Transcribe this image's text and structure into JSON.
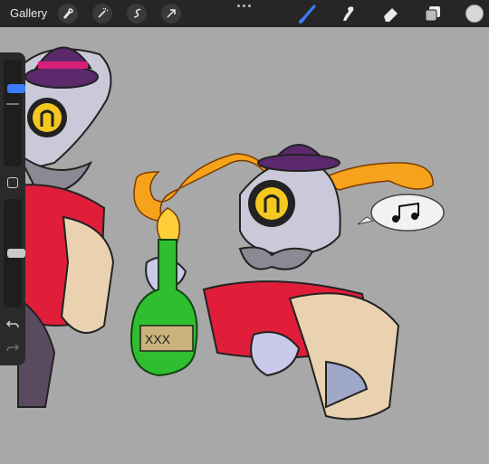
{
  "app": {
    "gallery_label": "Gallery"
  },
  "toolbar": {
    "left_tools": [
      "wrench-icon",
      "magic-wand-icon",
      "selection-icon",
      "transform-arrow-icon"
    ],
    "right_tools": [
      "brush-icon",
      "smudge-icon",
      "eraser-icon",
      "layers-icon"
    ],
    "active_tool": "brush-icon",
    "accent_color": "#3b7cff",
    "current_color": "#d7d7d7"
  },
  "sidebar": {
    "brush_size_level": 0.25,
    "opacity_level": 0.5,
    "modify_button_icon": "square-icon",
    "undo_icon": "undo-icon",
    "redo_icon": "redo-icon"
  },
  "canvas": {
    "background_color": "#a8a8a8",
    "speech_bubble_icon": "music-note-icon"
  }
}
